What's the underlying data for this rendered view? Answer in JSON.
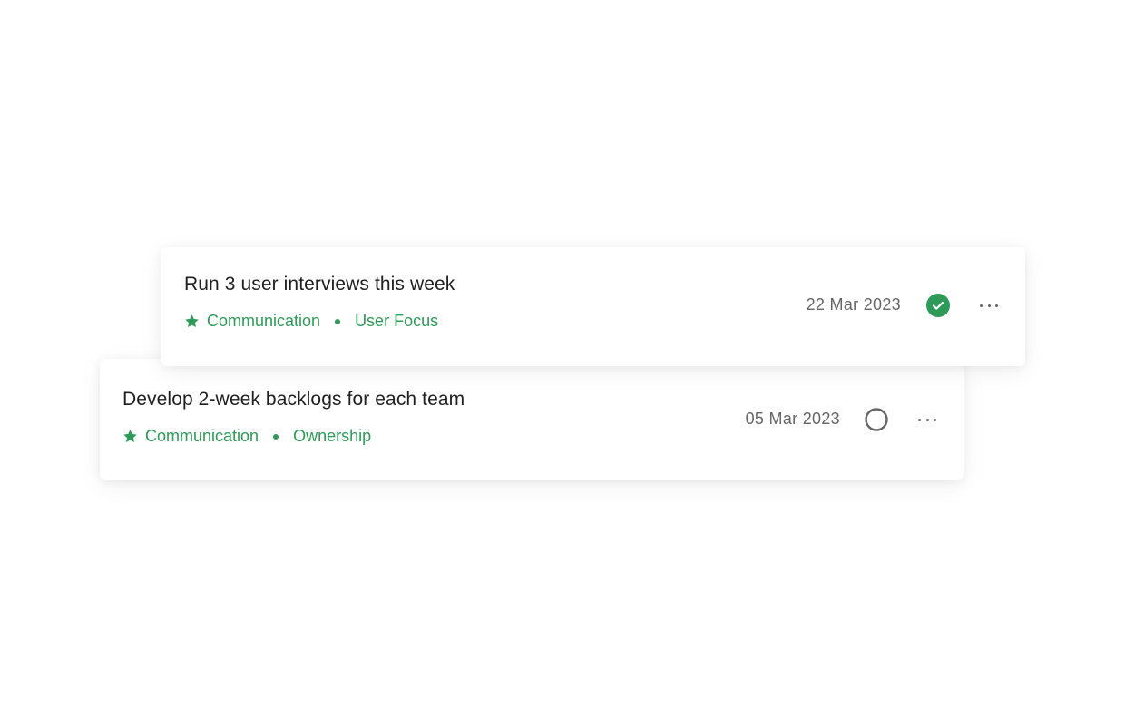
{
  "colors": {
    "accent": "#2e9a57",
    "title_text": "#1f1f1f",
    "muted_text": "#666666"
  },
  "goals": [
    {
      "title": "Run 3 user interviews this week",
      "tags": [
        "Communication",
        "User Focus"
      ],
      "date": "22 Mar 2023",
      "status": "completed",
      "status_icon": "check-circle-icon",
      "menu_icon": "more-horizontal-icon"
    },
    {
      "title": "Develop 2-week backlogs for each team",
      "tags": [
        "Communication",
        "Ownership"
      ],
      "date": "05 Mar 2023",
      "status": "incomplete",
      "status_icon": "empty-circle-icon",
      "menu_icon": "more-horizontal-icon"
    }
  ]
}
